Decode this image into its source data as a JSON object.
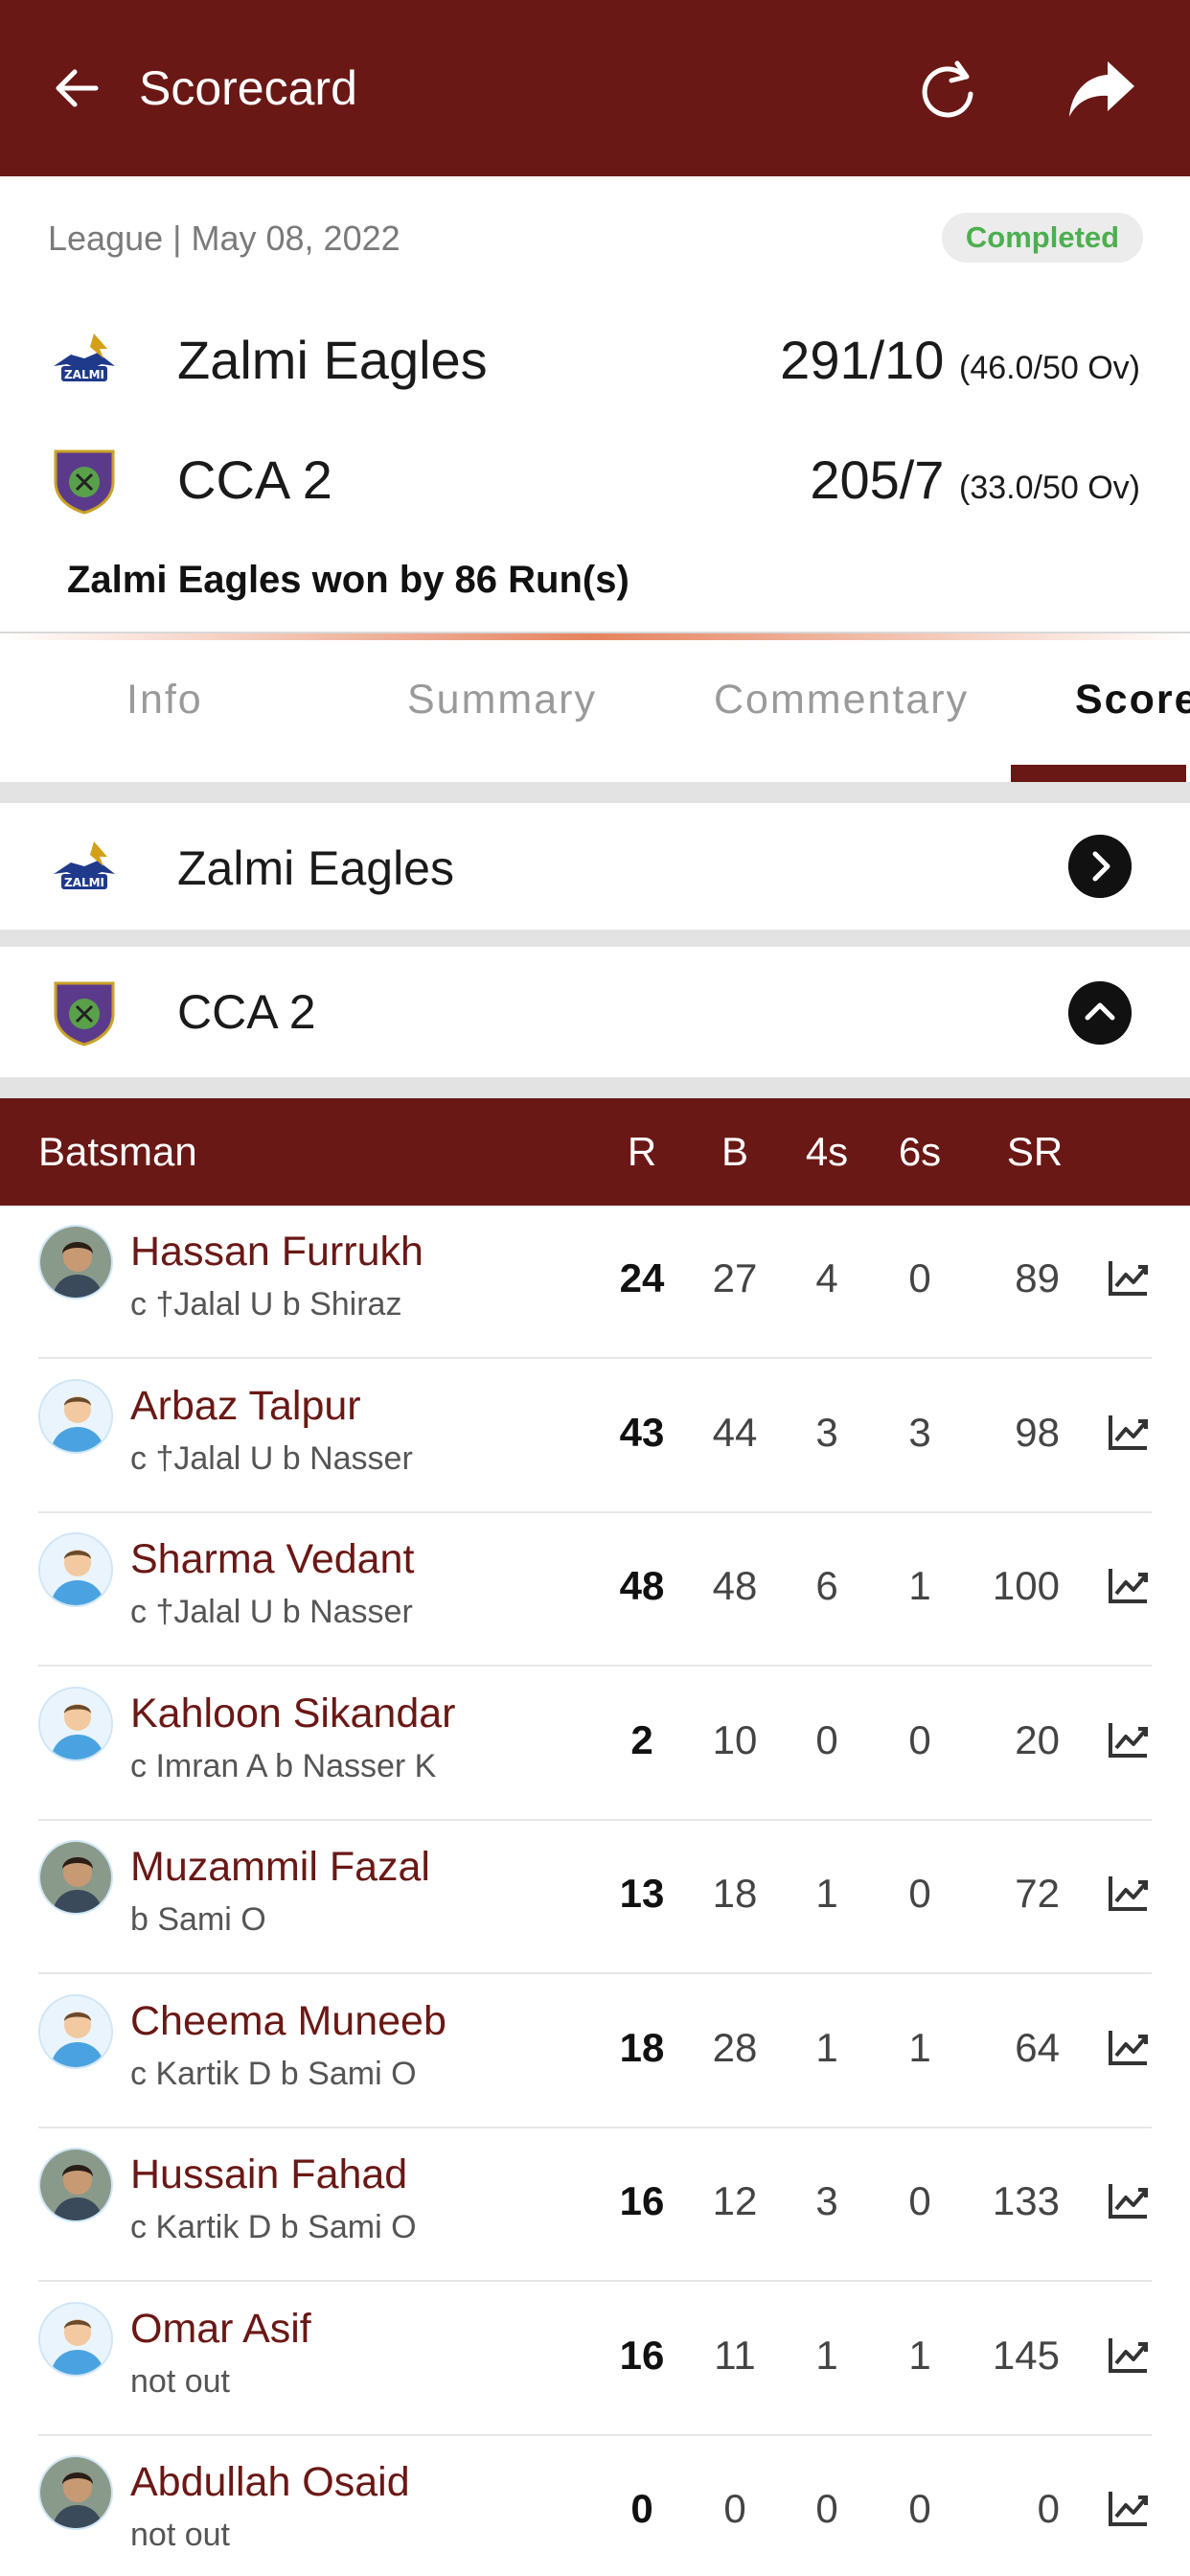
{
  "appbar": {
    "title": "Scorecard",
    "icons": [
      "back-arrow-icon",
      "refresh-icon",
      "share-icon"
    ]
  },
  "match": {
    "meta": "League | May 08, 2022",
    "status": "Completed",
    "teams": [
      {
        "name": "Zalmi Eagles",
        "score": "291/10",
        "overs": "(46.0/50 Ov)"
      },
      {
        "name": "CCA 2",
        "score": "205/7",
        "overs": "(33.0/50 Ov)"
      }
    ],
    "result": "Zalmi Eagles won by 86 Run(s)"
  },
  "tabs": [
    {
      "label": "Info",
      "active": false
    },
    {
      "label": "Summary",
      "active": false
    },
    {
      "label": "Commentary",
      "active": false
    },
    {
      "label": "Score",
      "active": true
    }
  ],
  "innings": [
    {
      "team": "Zalmi Eagles",
      "expanded": false
    },
    {
      "team": "CCA 2",
      "expanded": true
    }
  ],
  "batting": {
    "headers": {
      "batsman": "Batsman",
      "r": "R",
      "b": "B",
      "fours": "4s",
      "sixes": "6s",
      "sr": "SR"
    },
    "rows": [
      {
        "name": "Hassan Furrukh",
        "dismissal": "c †Jalal U b Shiraz",
        "r": "24",
        "b": "27",
        "fours": "4",
        "sixes": "0",
        "sr": "89",
        "avatar": "photo"
      },
      {
        "name": "Arbaz Talpur",
        "dismissal": "c †Jalal U b Nasser",
        "r": "43",
        "b": "44",
        "fours": "3",
        "sixes": "3",
        "sr": "98",
        "avatar": "placeholder"
      },
      {
        "name": "Sharma Vedant",
        "dismissal": "c †Jalal U b Nasser",
        "r": "48",
        "b": "48",
        "fours": "6",
        "sixes": "1",
        "sr": "100",
        "avatar": "placeholder"
      },
      {
        "name": "Kahloon Sikandar",
        "dismissal": "c Imran A b Nasser K",
        "r": "2",
        "b": "10",
        "fours": "0",
        "sixes": "0",
        "sr": "20",
        "avatar": "placeholder"
      },
      {
        "name": "Muzammil Fazal",
        "dismissal": "b Sami O",
        "r": "13",
        "b": "18",
        "fours": "1",
        "sixes": "0",
        "sr": "72",
        "avatar": "photo"
      },
      {
        "name": "Cheema Muneeb",
        "dismissal": "c Kartik D b Sami O",
        "r": "18",
        "b": "28",
        "fours": "1",
        "sixes": "1",
        "sr": "64",
        "avatar": "placeholder"
      },
      {
        "name": "Hussain Fahad",
        "dismissal": "c Kartik D b Sami O",
        "r": "16",
        "b": "12",
        "fours": "3",
        "sixes": "0",
        "sr": "133",
        "avatar": "photo"
      },
      {
        "name": "Omar Asif",
        "dismissal": "not out",
        "r": "16",
        "b": "11",
        "fours": "1",
        "sixes": "1",
        "sr": "145",
        "avatar": "placeholder"
      },
      {
        "name": "Abdullah Osaid",
        "dismissal": "not out",
        "r": "0",
        "b": "0",
        "fours": "0",
        "sixes": "0",
        "sr": "0",
        "avatar": "photo"
      }
    ]
  },
  "colors": {
    "brand": "#6a1815",
    "status_green": "#4caf50",
    "player_name": "#6a1815"
  }
}
